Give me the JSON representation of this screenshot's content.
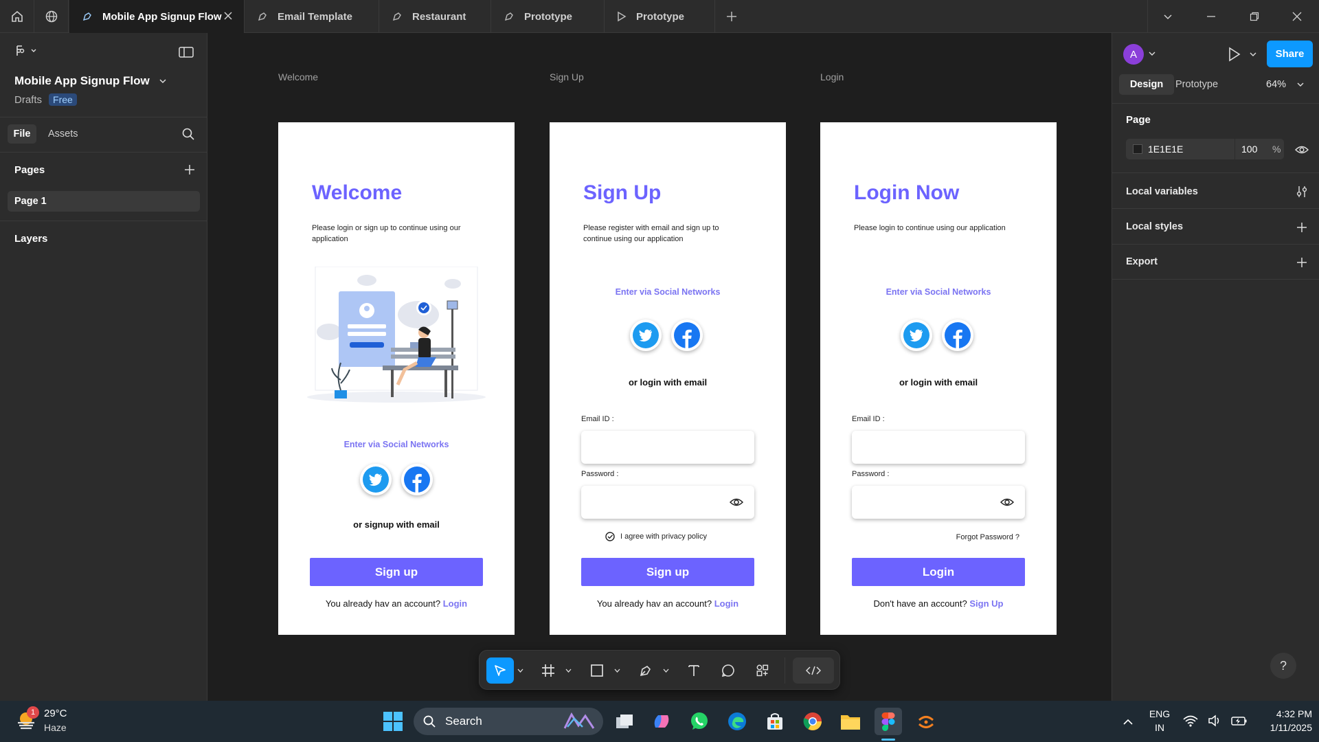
{
  "tabs": [
    {
      "label": "Mobile App Signup Flow",
      "active": true
    },
    {
      "label": "Email Template"
    },
    {
      "label": "Restaurant"
    },
    {
      "label": "Prototype"
    },
    {
      "label": "Prototype"
    }
  ],
  "left": {
    "file_name": "Mobile App Signup Flow",
    "drafts": "Drafts",
    "plan": "Free",
    "tab_file": "File",
    "tab_assets": "Assets",
    "pages_heading": "Pages",
    "page1": "Page 1",
    "layers_heading": "Layers"
  },
  "frames": {
    "welcome": {
      "label": "Welcome",
      "title": "Welcome",
      "sub": "Please login or sign up to continue using our application",
      "social": "Enter via Social Networks",
      "or": "or  signup with email",
      "cta": "Sign up",
      "foot": "You already hav an account?",
      "foot_link": "Login"
    },
    "signup": {
      "label": "Sign Up",
      "title": "Sign Up",
      "sub": "Please register with email and sign up to continue using our application",
      "social": "Enter via Social Networks",
      "or": "or  login with email",
      "email_label": "Email ID :",
      "password_label": "Password :",
      "agree": "I agree with privacy policy",
      "cta": "Sign up",
      "foot": "You already hav an account?",
      "foot_link": "Login"
    },
    "login": {
      "label": "Login",
      "title": "Login Now",
      "sub": "Please login to continue using our application",
      "social": "Enter via Social Networks",
      "or": "or  login with email",
      "email_label": "Email ID :",
      "password_label": "Password :",
      "forgot": "Forgot Password ?",
      "cta": "Login",
      "foot": "Don't have an account?",
      "foot_link": "Sign Up"
    }
  },
  "right": {
    "avatar": "A",
    "share": "Share",
    "tab_design": "Design",
    "tab_prototype": "Prototype",
    "zoom": "64%",
    "page_heading": "Page",
    "page_color": "1E1E1E",
    "page_opacity": "100",
    "percent": "%",
    "local_variables": "Local variables",
    "local_styles": "Local styles",
    "export": "Export"
  },
  "taskbar": {
    "temp": "29°C",
    "weather": "Haze",
    "weather_badge": "1",
    "search": "Search",
    "lang": "ENG",
    "region": "IN",
    "time": "4:32 PM",
    "date": "1/11/2025"
  },
  "colors": {
    "accent": "#6c63ff",
    "link": "#7b74f2",
    "share": "#0d99ff",
    "canvas": "#1e1e1e",
    "panel": "#2c2c2c"
  }
}
